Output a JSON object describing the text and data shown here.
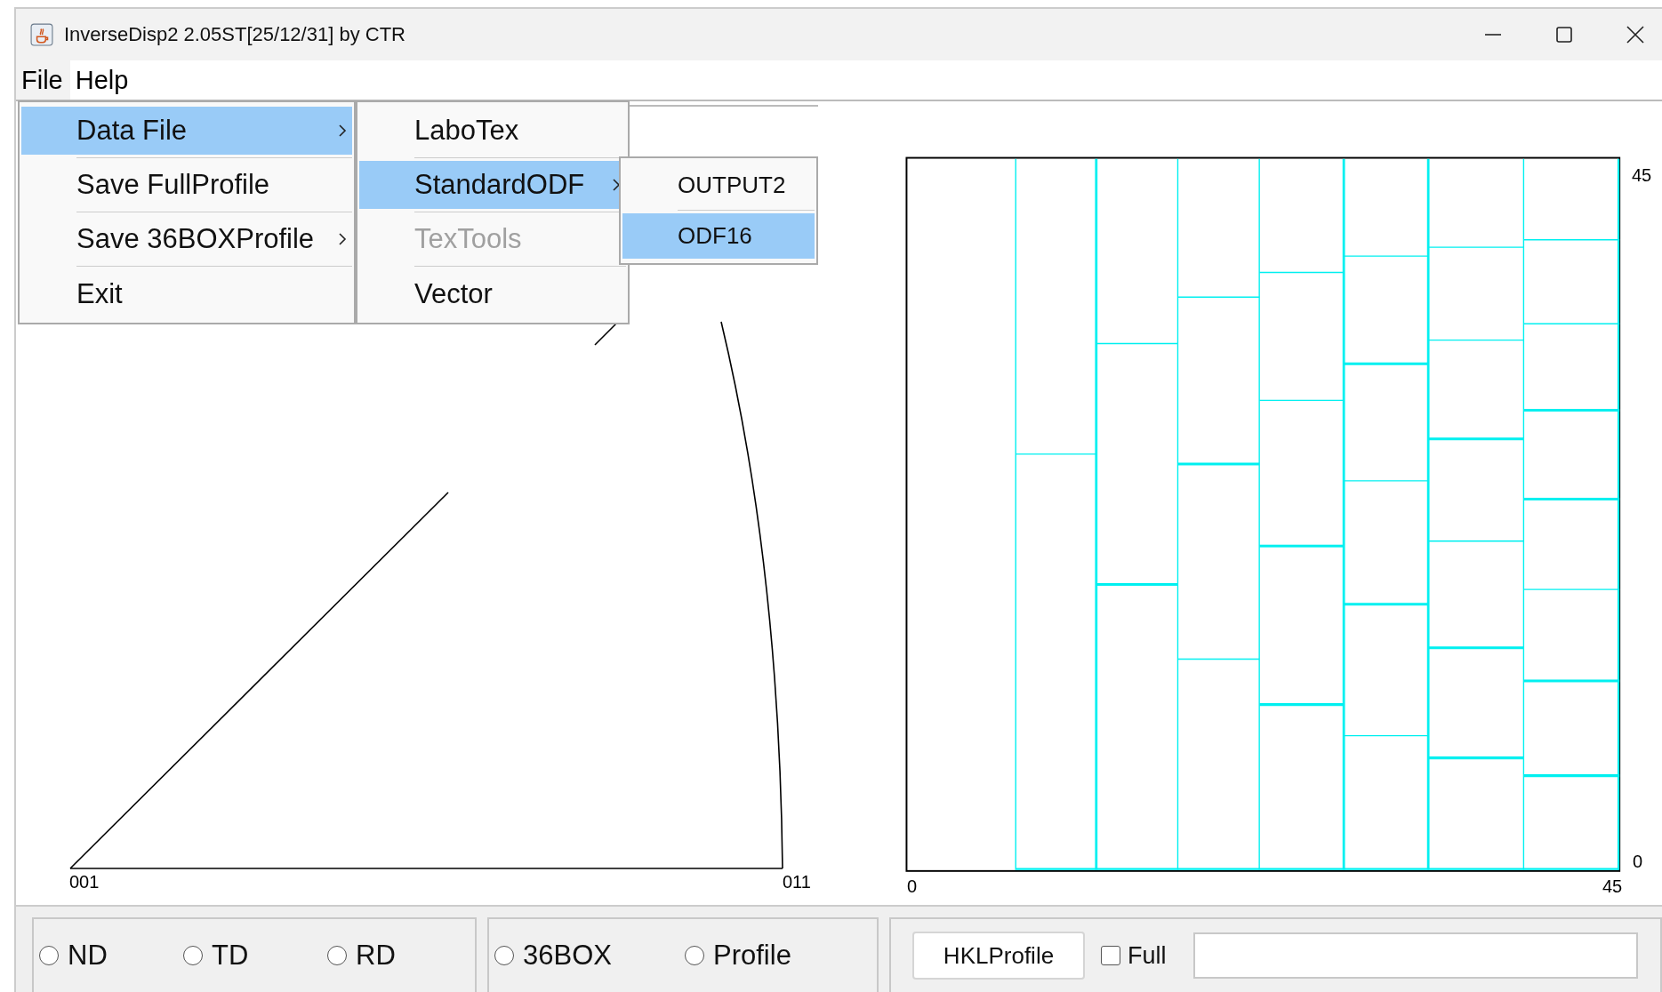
{
  "window": {
    "title": "InverseDisp2 2.05ST[25/12/31] by CTR"
  },
  "menu_bar": [
    {
      "label": "File",
      "selected": true
    },
    {
      "label": "Help",
      "selected": false
    }
  ],
  "menus": [
    {
      "items": [
        {
          "label": "Data File",
          "selected": true,
          "has_submenu": true,
          "disabled": false
        },
        {
          "label": "Save FullProfile",
          "selected": false,
          "has_submenu": false,
          "disabled": false
        },
        {
          "label": "Save 36BOXProfile",
          "selected": false,
          "has_submenu": true,
          "disabled": false
        },
        {
          "label": "Exit",
          "selected": false,
          "has_submenu": false,
          "disabled": false
        }
      ]
    },
    {
      "items": [
        {
          "label": "LaboTex",
          "selected": false,
          "has_submenu": false,
          "disabled": false
        },
        {
          "label": "StandardODF",
          "selected": true,
          "has_submenu": true,
          "disabled": false
        },
        {
          "label": "TexTools",
          "selected": false,
          "has_submenu": false,
          "disabled": true
        },
        {
          "label": "Vector",
          "selected": false,
          "has_submenu": false,
          "disabled": false
        }
      ]
    },
    {
      "items": [
        {
          "label": "OUTPUT2",
          "selected": false,
          "has_submenu": false,
          "disabled": false
        },
        {
          "label": "ODF16",
          "selected": true,
          "has_submenu": false,
          "disabled": false
        }
      ]
    }
  ],
  "inverse_pole_figure": {
    "corner_labels": [
      "001",
      "011"
    ]
  },
  "box_plot": {
    "x_labels": [
      "0",
      "45"
    ],
    "y_labels": [
      "45",
      "0"
    ]
  },
  "direction_options": [
    {
      "label": "ND",
      "selected": false
    },
    {
      "label": "TD",
      "selected": false
    },
    {
      "label": "RD",
      "selected": false
    }
  ],
  "profile_options": [
    {
      "label": "36BOX",
      "selected": false
    },
    {
      "label": "Profile",
      "selected": false
    }
  ],
  "hkl_button": "HKLProfile",
  "full_checkbox": {
    "label": "Full",
    "checked": false
  }
}
